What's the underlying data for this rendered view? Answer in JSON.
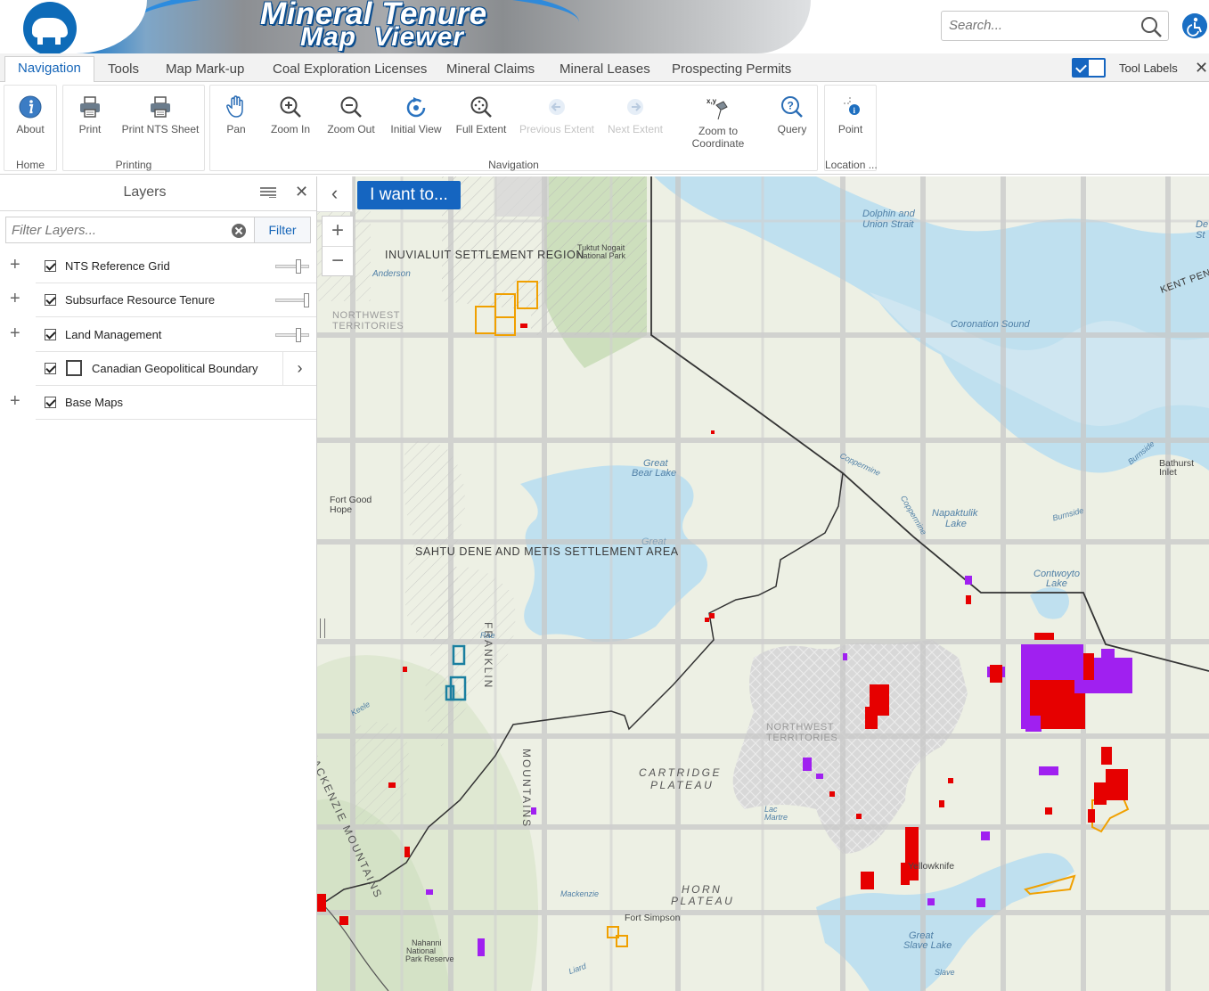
{
  "banner": {
    "title": "Mineral Tenure",
    "subtitle": "Map Viewer"
  },
  "search": {
    "placeholder": "Search..."
  },
  "tabs": [
    {
      "label": "Navigation",
      "active": true
    },
    {
      "label": "Tools"
    },
    {
      "label": "Map Mark-up"
    },
    {
      "label": "Coal Exploration Licenses"
    },
    {
      "label": "Mineral Claims"
    },
    {
      "label": "Mineral Leases"
    },
    {
      "label": "Prospecting Permits"
    }
  ],
  "tool_labels": {
    "label": "Tool Labels",
    "enabled": true
  },
  "ribbon": {
    "groups": [
      {
        "label": "Home",
        "tools": [
          {
            "label": "About",
            "icon": "info-icon"
          }
        ]
      },
      {
        "label": "Printing",
        "tools": [
          {
            "label": "Print",
            "icon": "printer-icon"
          },
          {
            "label": "Print NTS Sheet",
            "icon": "printer-icon"
          }
        ]
      },
      {
        "label": "Navigation",
        "tools": [
          {
            "label": "Pan",
            "icon": "hand-icon"
          },
          {
            "label": "Zoom In",
            "icon": "zoom-in-icon"
          },
          {
            "label": "Zoom Out",
            "icon": "zoom-out-icon"
          },
          {
            "label": "Initial View",
            "icon": "refresh-icon"
          },
          {
            "label": "Full Extent",
            "icon": "full-extent-icon"
          },
          {
            "label": "Previous Extent",
            "icon": "arrow-left-icon",
            "disabled": true
          },
          {
            "label": "Next Extent",
            "icon": "arrow-right-icon",
            "disabled": true
          },
          {
            "label": "Zoom to Coordinate",
            "line1": "Zoom to",
            "line2": "Coordinate",
            "icon": "pin-xy-icon",
            "xy": "x,y"
          },
          {
            "label": "Query",
            "icon": "query-icon"
          }
        ]
      },
      {
        "label": "Location ...",
        "tools": [
          {
            "label": "Point",
            "icon": "point-info-icon"
          }
        ]
      }
    ]
  },
  "layers_panel": {
    "title": "Layers",
    "filter_placeholder": "Filter Layers...",
    "filter_button": "Filter",
    "layers": [
      {
        "name": "NTS Reference Grid",
        "checked": true,
        "expandable": true,
        "opacity": 0.7
      },
      {
        "name": "Subsurface Resource Tenure",
        "checked": true,
        "expandable": true,
        "opacity": 1.0
      },
      {
        "name": "Land Management",
        "checked": true,
        "expandable": true,
        "opacity": 0.7
      },
      {
        "name": "Canadian Geopolitical Boundary",
        "checked": true,
        "expandable": false,
        "has_swatch": true,
        "has_submenu": true
      },
      {
        "name": "Base Maps",
        "checked": true,
        "expandable": true
      }
    ]
  },
  "map": {
    "i_want_to": "I want to...",
    "labels": {
      "inuvialuit": "INUVIALUIT SETTLEMENT REGION",
      "tuktut_1": "Tuktut Nogait",
      "tuktut_2": "National Park",
      "anderson": "Anderson",
      "nwt_1_a": "NORTHWEST",
      "nwt_1_b": "TERRITORIES",
      "dolphin_1": "Dolphin and",
      "dolphin_2": "Union Strait",
      "coronation": "Coronation Sound",
      "kent": "KENT PEN",
      "de_1": "De",
      "de_2": "St",
      "great_bear_1": "Great",
      "great_bear_2": "Bear Lake",
      "great_bear_faint": "Great",
      "coppermine": "Coppermine",
      "coppermine_2": "Coppermine",
      "burnside": "Burnside",
      "burnside_2": "Burnside",
      "bathurst_1": "Bathurst",
      "bathurst_2": "Inlet",
      "napaktulik_1": "Napaktulik",
      "napaktulik_2": "Lake",
      "contwoyto_1": "Contwoyto",
      "contwoyto_2": "Lake",
      "fort_good_hope_1": "Fort Good",
      "fort_good_hope_2": "Hope",
      "sahtu": "SAHTU DENE AND METIS SETTLEMENT AREA",
      "nwt_2_a": "NORTHWEST",
      "nwt_2_b": "TERRITORIES",
      "cartridge_1": "CARTRIDGE",
      "cartridge_2": "PLATEAU",
      "franklin": "FRANKLIN",
      "mountains": "MOUNTAINS",
      "mackenzie_mtns": "MACKENZIE MOUNTAINS",
      "horn_1": "HORN",
      "horn_2": "PLATEAU",
      "yellowknife": "Yellowknife",
      "great_slave_1": "Great",
      "great_slave_2": "Slave Lake",
      "slave": "Slave",
      "fort_simpson": "Fort Simpson",
      "mackenzie_river": "Mackenzie",
      "nahanni_1": "Nahanni",
      "nahanni_2": "National",
      "nahanni_3": "Park Reserve",
      "liard": "Liard",
      "lac_la_martre_1": "Lac",
      "lac_la_martre_2": "Martre",
      "keele": "Keele",
      "rae": "Rae"
    },
    "colors": {
      "claim_red": "#e60000",
      "lease_purple": "#a020f0",
      "permit_orange": "#f0a000",
      "coal_teal": "#1a7fa0",
      "water": "#bfe0ef",
      "land": "#edf0e4",
      "park": "#c9ddb8",
      "grid": "#c8c8c8",
      "settlement_hatch": "#a9a9a9"
    }
  }
}
